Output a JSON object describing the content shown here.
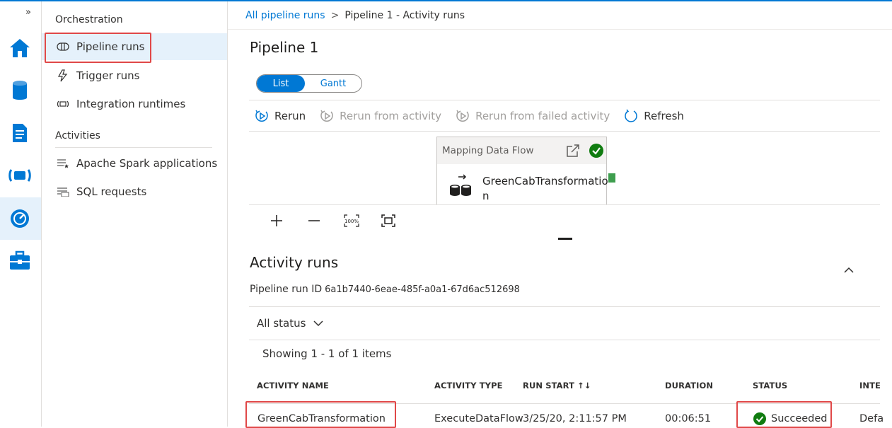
{
  "rail": {
    "expand": "»",
    "icons": [
      "home-icon",
      "data-icon",
      "develop-icon",
      "integrate-icon",
      "monitor-icon",
      "manage-icon"
    ]
  },
  "nav": {
    "group1": "Orchestration",
    "items1": [
      {
        "label": "Pipeline runs",
        "icon": "pipeline-runs-icon"
      },
      {
        "label": "Trigger runs",
        "icon": "trigger-icon"
      },
      {
        "label": "Integration runtimes",
        "icon": "integration-runtime-icon"
      }
    ],
    "group2": "Activities",
    "items2": [
      {
        "label": "Apache Spark applications",
        "icon": "spark-apps-icon"
      },
      {
        "label": "SQL requests",
        "icon": "sql-requests-icon"
      }
    ]
  },
  "breadcrumb": {
    "link": "All pipeline runs",
    "sep": ">",
    "current": "Pipeline 1 - Activity runs"
  },
  "page_title": "Pipeline 1",
  "view_toggle": {
    "list": "List",
    "gantt": "Gantt"
  },
  "toolbar": {
    "rerun": "Rerun",
    "rerun_from_activity": "Rerun from activity",
    "rerun_from_failed": "Rerun from failed activity",
    "refresh": "Refresh"
  },
  "node": {
    "type": "Mapping Data Flow",
    "name": "GreenCabTransformation",
    "status_color": "#107c10"
  },
  "zoom_controls": [
    "zoom-in-icon",
    "zoom-out-icon",
    "zoom-100-icon",
    "fit-to-screen-icon"
  ],
  "activity_runs": {
    "title": "Activity runs",
    "run_id_label": "Pipeline run ID",
    "run_id": "6a1b7440-6eae-485f-a0a1-67d6ac512698",
    "filter": "All status",
    "showing": "Showing 1 - 1 of 1 items",
    "columns": [
      "ACTIVITY NAME",
      "ACTIVITY TYPE",
      "RUN START ↑↓",
      "DURATION",
      "STATUS",
      "INTE"
    ],
    "rows": [
      {
        "name": "GreenCabTransformation",
        "type": "ExecuteDataFlow",
        "run_start": "3/25/20, 2:11:57 PM",
        "duration": "00:06:51",
        "status": "Succeeded",
        "integration": "Defa"
      }
    ]
  },
  "colors": {
    "accent": "#0078d4",
    "success": "#107c10",
    "highlight": "#e04848"
  }
}
